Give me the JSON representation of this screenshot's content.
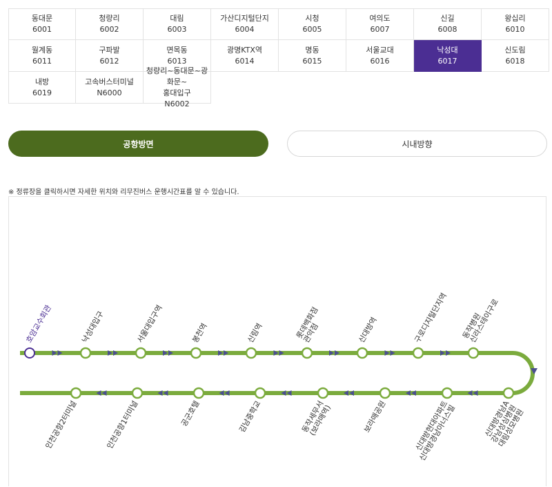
{
  "stops": [
    {
      "name": "동대문",
      "code": "6001"
    },
    {
      "name": "청량리",
      "code": "6002"
    },
    {
      "name": "대림",
      "code": "6003"
    },
    {
      "name": "가산디지털단지",
      "code": "6004"
    },
    {
      "name": "시청",
      "code": "6005"
    },
    {
      "name": "여의도",
      "code": "6007"
    },
    {
      "name": "신길",
      "code": "6008"
    },
    {
      "name": "왕십리",
      "code": "6010"
    },
    {
      "name": "월계동",
      "code": "6011"
    },
    {
      "name": "구파발",
      "code": "6012"
    },
    {
      "name": "면목동",
      "code": "6013"
    },
    {
      "name": "광명KTX역",
      "code": "6014"
    },
    {
      "name": "명동",
      "code": "6015"
    },
    {
      "name": "서울교대",
      "code": "6016"
    },
    {
      "name": "낙성대",
      "code": "6017"
    },
    {
      "name": "신도림",
      "code": "6018"
    },
    {
      "name": "내방",
      "code": "6019"
    },
    {
      "name": "고속버스터미널",
      "code": "N6000"
    },
    {
      "name": "청량리~동대문~광화문~\n홍대입구",
      "code": "N6002"
    }
  ],
  "selected_stop": "6017",
  "direction_buttons": {
    "airport": "공항방면",
    "city": "시내방향"
  },
  "notice": "※ 정류장을 클릭하시면 자세한 위치와 리무진버스 운행시간표를 알 수 있습니다.",
  "colors": {
    "route": "#7bab3d",
    "accent": "#4b2e93",
    "arrow": "#4b4f8e",
    "button_active": "#4c6b1e"
  },
  "route": {
    "top_row": [
      {
        "lines": [
          "호암교수회관"
        ],
        "current": true
      },
      {
        "lines": [
          "낙성대입구"
        ]
      },
      {
        "lines": [
          "서울대입구역"
        ]
      },
      {
        "lines": [
          "봉천역"
        ]
      },
      {
        "lines": [
          "신림역"
        ]
      },
      {
        "lines": [
          "롯데백화점",
          "관악점"
        ]
      },
      {
        "lines": [
          "신대방역"
        ]
      },
      {
        "lines": [
          "구로디지털단지역"
        ]
      },
      {
        "lines": [
          "동작병원",
          "신라스테이구로"
        ]
      }
    ],
    "bottom_row": [
      {
        "lines": [
          "인천공항2터미널"
        ]
      },
      {
        "lines": [
          "인천공항1터미널"
        ]
      },
      {
        "lines": [
          "공군호텔"
        ]
      },
      {
        "lines": [
          "김남중학교"
        ]
      },
      {
        "lines": [
          "동작세무서",
          "(보라매역)"
        ]
      },
      {
        "lines": [
          "보라매공원"
        ]
      },
      {
        "lines": [
          "신대방현대아파트",
          "신대방경남아너스빌"
        ]
      },
      {
        "lines": [
          "신대방경남A",
          "강남성심병원",
          "대림성모병원"
        ]
      }
    ]
  }
}
